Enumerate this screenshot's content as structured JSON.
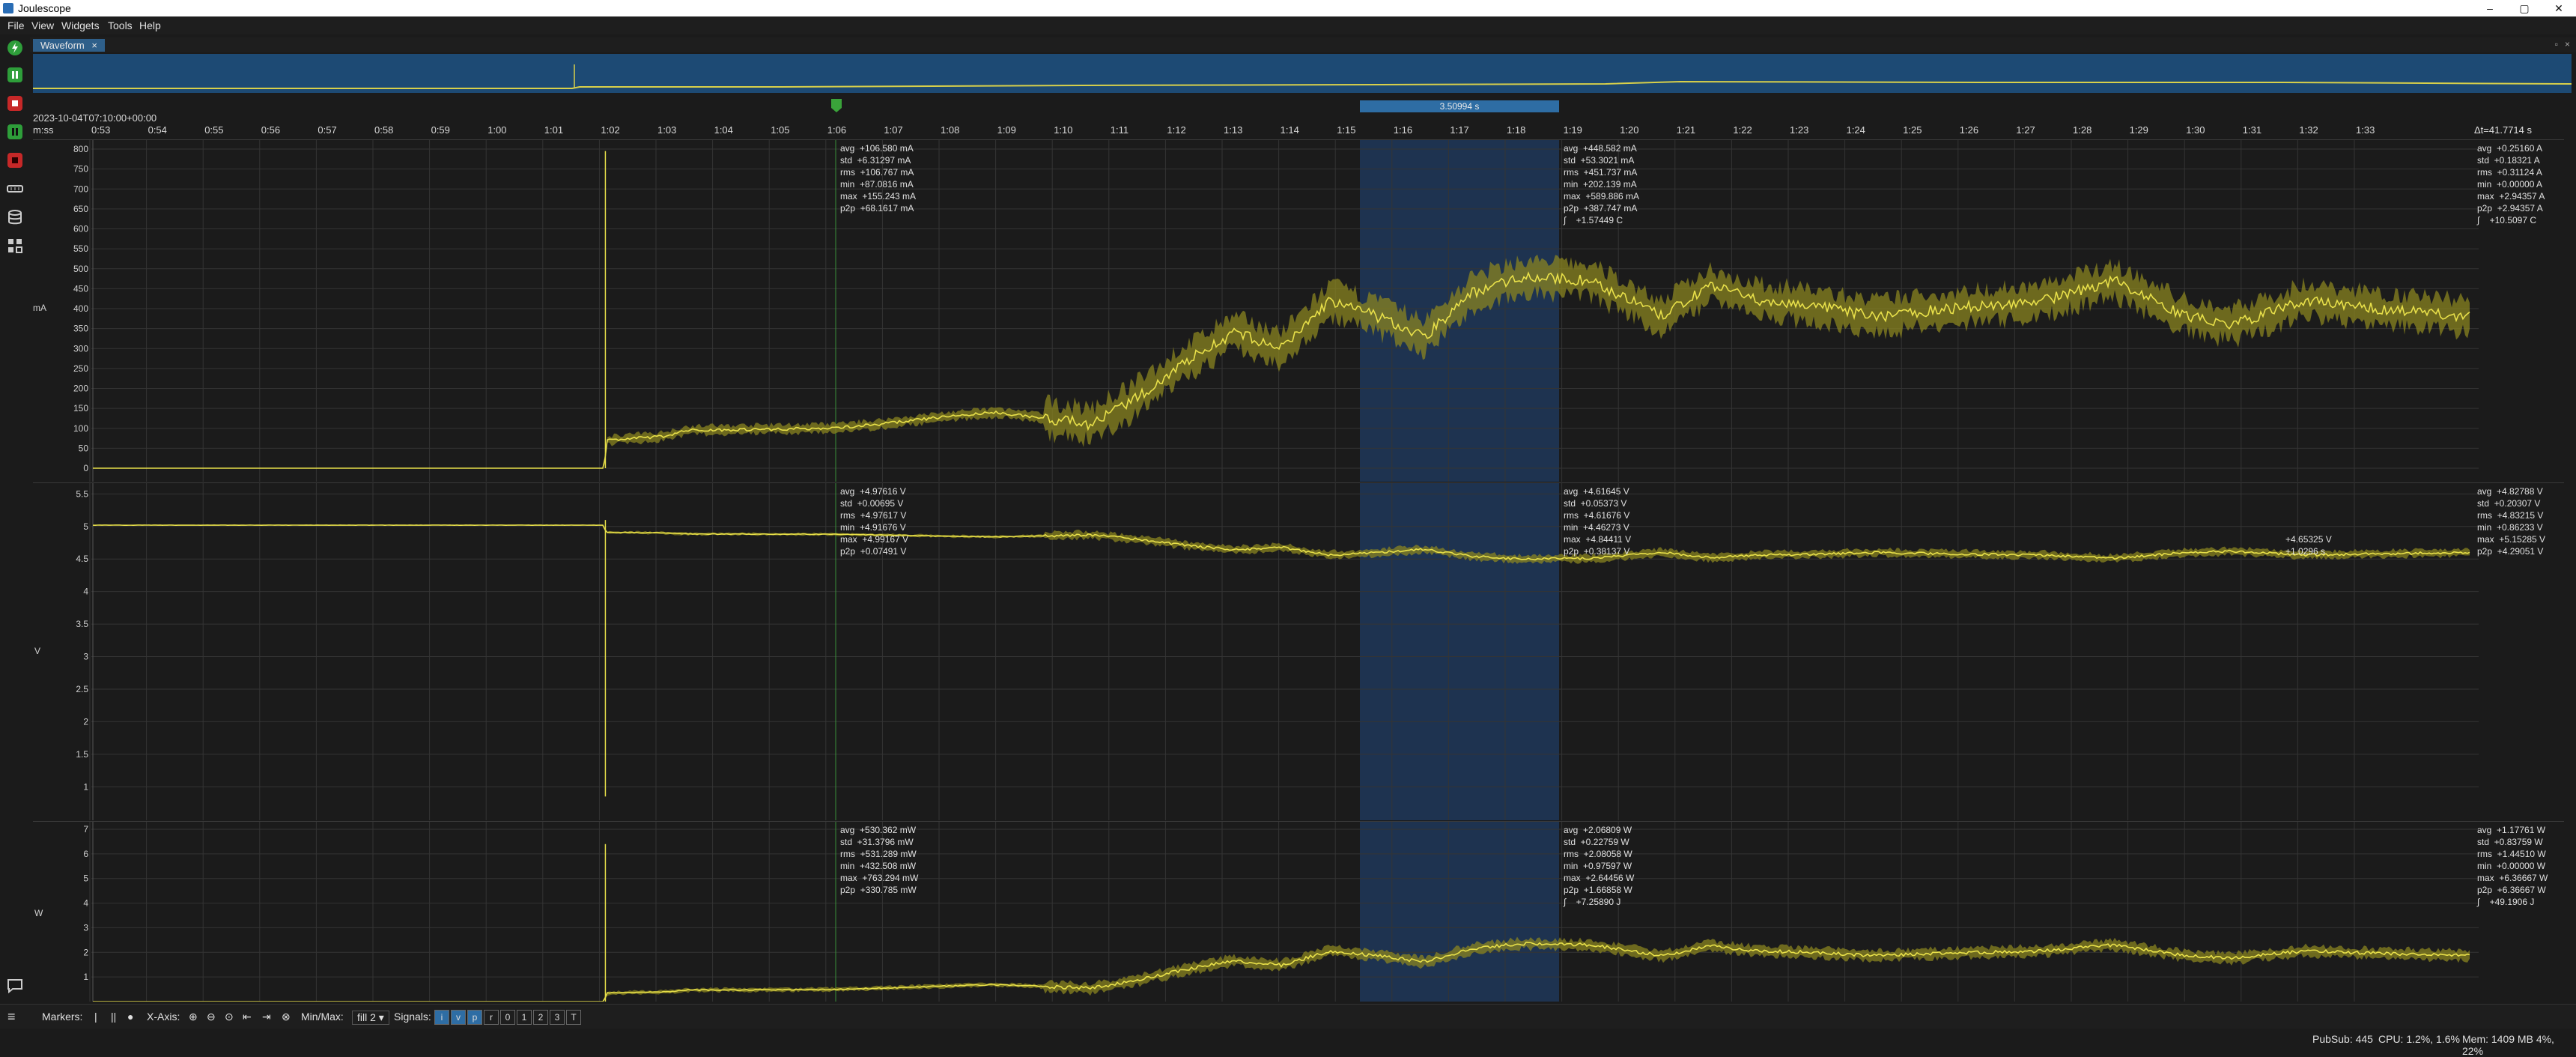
{
  "window": {
    "title": "Joulescope",
    "minimize": "–",
    "maximize": "▢",
    "close": "✕"
  },
  "menu": [
    "File",
    "View",
    "Widgets",
    "Tools",
    "Help"
  ],
  "tab": {
    "label": "Waveform",
    "close": "×"
  },
  "xaxis": {
    "start_label": "2023-10-04T07:10:00+00:00",
    "unit_label": "m:ss",
    "ticks": [
      "0:53",
      "0:54",
      "0:55",
      "0:56",
      "0:57",
      "0:58",
      "0:59",
      "1:00",
      "1:01",
      "1:02",
      "1:03",
      "1:04",
      "1:05",
      "1:06",
      "1:07",
      "1:08",
      "1:09",
      "1:10",
      "1:11",
      "1:12",
      "1:13",
      "1:14",
      "1:15",
      "1:16",
      "1:17",
      "1:18",
      "1:19",
      "1:20",
      "1:21",
      "1:22",
      "1:23",
      "1:24",
      "1:25",
      "1:26",
      "1:27",
      "1:28",
      "1:29",
      "1:30",
      "1:31",
      "1:32",
      "1:33"
    ],
    "delta_label": "Δt=41.7714 s",
    "selection_label": "3.50994 s",
    "marker_label": "1"
  },
  "plots": {
    "current": {
      "unit": "mA",
      "ticks": [
        "800",
        "750",
        "700",
        "650",
        "600",
        "550",
        "500",
        "450",
        "400",
        "350",
        "300",
        "250",
        "200",
        "150",
        "100",
        "50",
        "0"
      ],
      "stats_left": [
        "avg  +106.580 mA",
        "std  +6.31297 mA",
        "rms  +106.767 mA",
        "min  +87.0816 mA",
        "max  +155.243 mA",
        "p2p  +68.1617 mA"
      ],
      "stats_mid": [
        "avg  +448.582 mA",
        "std  +53.3021 mA",
        "rms  +451.737 mA",
        "min  +202.139 mA",
        "max  +589.886 mA",
        "p2p  +387.747 mA",
        "∫    +1.57449 C"
      ],
      "stats_right": [
        "avg  +0.25160 A",
        "std  +0.18321 A",
        "rms  +0.31124 A",
        "min  +0.00000 A",
        "max  +2.94357 A",
        "p2p  +2.94357 A",
        "∫    +10.5097 C"
      ]
    },
    "voltage": {
      "unit": "V",
      "ticks": [
        "5.5",
        "5",
        "4.5",
        "4",
        "3.5",
        "3",
        "2.5",
        "2",
        "1.5",
        "1"
      ],
      "stats_left": [
        "avg  +4.97616 V",
        "std  +0.00695 V",
        "rms  +4.97617 V",
        "min  +4.91676 V",
        "max  +4.99167 V",
        "p2p  +0.07491 V"
      ],
      "stats_mid": [
        "avg  +4.61645 V",
        "std  +0.05373 V",
        "rms  +4.61676 V",
        "min  +4.46273 V",
        "max  +4.84411 V",
        "p2p  +0.38137 V"
      ],
      "stats_right": [
        "avg  +4.82788 V",
        "std  +0.20307 V",
        "rms  +4.83215 V",
        "min  +0.86233 V",
        "max  +5.15285 V",
        "p2p  +4.29051 V"
      ],
      "inline_value_a": "+4.65325 V",
      "inline_value_b": "+1.0296 s"
    },
    "power": {
      "unit": "W",
      "ticks": [
        "7",
        "6",
        "5",
        "4",
        "3",
        "2",
        "1"
      ],
      "stats_left": [
        "avg  +530.362 mW",
        "std  +31.3796 mW",
        "rms  +531.289 mW",
        "min  +432.508 mW",
        "max  +763.294 mW",
        "p2p  +330.785 mW"
      ],
      "stats_mid": [
        "avg  +2.06809 W",
        "std  +0.22759 W",
        "rms  +2.08058 W",
        "min  +0.97597 W",
        "max  +2.64456 W",
        "p2p  +1.66858 W",
        "∫    +7.25890 J"
      ],
      "stats_right": [
        "avg  +1.17761 W",
        "std  +0.83759 W",
        "rms  +1.44510 W",
        "min  +0.00000 W",
        "max  +6.36667 W",
        "p2p  +6.36667 W",
        "∫    +49.1906 J"
      ]
    }
  },
  "bottombar": {
    "markers_label": "Markers:",
    "xaxis_label": "X-Axis:",
    "minmax_label": "Min/Max:",
    "minmax_value": "fill 2",
    "signals_label": "Signals:",
    "signal_buttons": [
      "i",
      "v",
      "p",
      "r",
      "0",
      "1",
      "2",
      "3",
      "T"
    ]
  },
  "statusbar": {
    "pubsub": "PubSub: 445",
    "cpu": "CPU: 1.2%, 1.6%",
    "mem": "Mem: 1409 MB 4%, 22%"
  },
  "colors": {
    "trace": "#e8e04a",
    "trace_fill": "#8a8420",
    "selection": "#2a4a6e",
    "accent": "#2e6da4"
  }
}
